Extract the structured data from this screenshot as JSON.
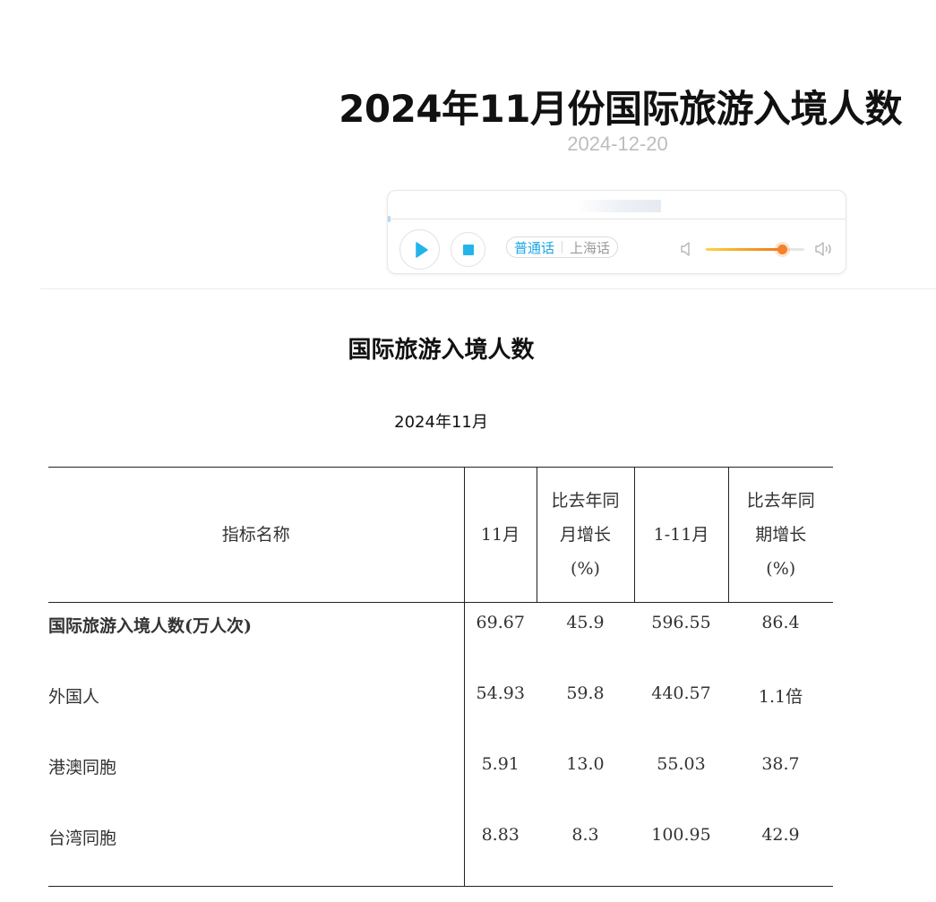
{
  "article": {
    "title": "2024年11月份国际旅游入境人数",
    "date": "2024-12-20"
  },
  "player": {
    "languages": [
      "普通话",
      "上海话"
    ],
    "active_language": "普通话",
    "volume_level": 0.77,
    "colors": {
      "accent": "#23b4ea",
      "volume": "#f5822a"
    },
    "icons": [
      "play-icon",
      "stop-icon",
      "volume-low-icon",
      "volume-high-icon"
    ]
  },
  "table": {
    "title": "国际旅游入境人数",
    "period": "2024年11月",
    "headers": {
      "name": "指标名称",
      "month": "11月",
      "month_yoy": [
        "比去年同",
        "月增长",
        "(%)"
      ],
      "ytd": "1-11月",
      "ytd_yoy": [
        "比去年同",
        "期增长",
        "(%)"
      ]
    },
    "rows": [
      {
        "name": "国际旅游入境人数(万人次)",
        "month": "69.67",
        "month_yoy": "45.9",
        "ytd": "596.55",
        "ytd_yoy": "86.4"
      },
      {
        "name": "外国人",
        "month": "54.93",
        "month_yoy": "59.8",
        "ytd": "440.57",
        "ytd_yoy": "1.1倍"
      },
      {
        "name": "港澳同胞",
        "month": "5.91",
        "month_yoy": "13.0",
        "ytd": "55.03",
        "ytd_yoy": "38.7"
      },
      {
        "name": "台湾同胞",
        "month": "8.83",
        "month_yoy": "8.3",
        "ytd": "100.95",
        "ytd_yoy": "42.9"
      }
    ]
  }
}
